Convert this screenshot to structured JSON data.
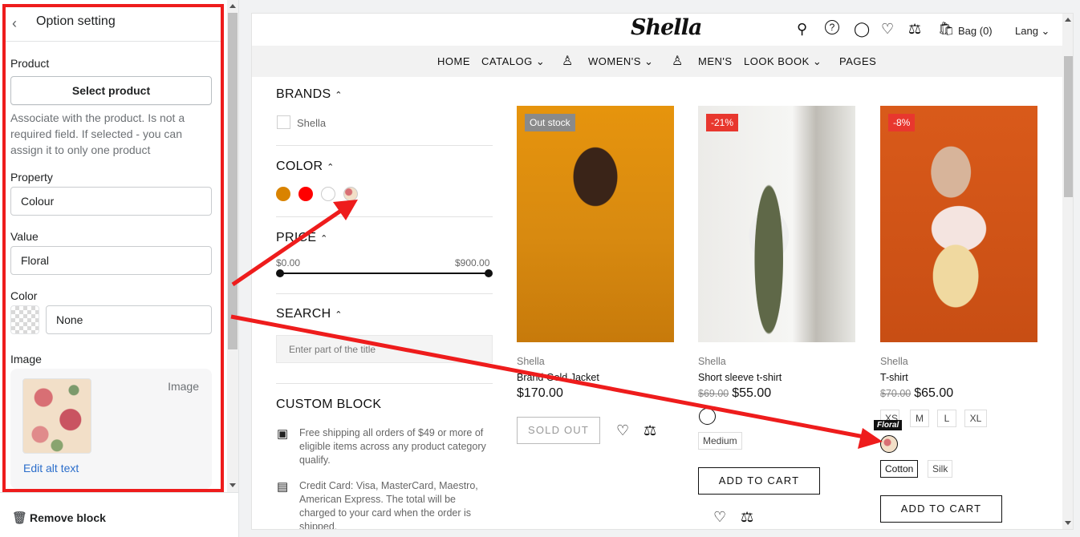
{
  "sidebar": {
    "title": "Option setting",
    "product_label": "Product",
    "select_product": "Select product",
    "help_text": "Associate with the product. Is not a required field. If selected - you can assign it to only one product",
    "property_label": "Property",
    "property_value": "Colour",
    "value_label": "Value",
    "value_value": "Floral",
    "color_label": "Color",
    "color_value": "None",
    "image_label": "Image",
    "image_word": "Image",
    "edit_alt": "Edit alt text",
    "remove_block": "Remove block"
  },
  "store": {
    "logo": "Shella",
    "bag": "Bag (0)",
    "lang": "Lang",
    "nav": [
      "HOME",
      "CATALOG",
      "WOMEN'S",
      "MEN'S",
      "LOOK BOOK",
      "PAGES"
    ]
  },
  "filters": {
    "brands_title": "BRANDS",
    "brand": "Shella",
    "color_title": "COLOR",
    "colors": [
      "#d98300",
      "#ff0000",
      "#ffffff",
      "floral"
    ],
    "price_title": "PRICE",
    "price_min": "$0.00",
    "price_max": "$900.00",
    "search_title": "SEARCH",
    "search_placeholder": "Enter part of the title",
    "custom_title": "CUSTOM BLOCK",
    "custom_items": [
      "Free shipping all orders of $49 or more of eligible items across any product category qualify.",
      "Credit Card: Visa, MasterCard, Maestro, American Express. The total will be charged to your card when the order is shipped."
    ]
  },
  "products": [
    {
      "badge": "Out stock",
      "vendor": "Shella",
      "name": "Brand Gold Jacket",
      "price": "$170.00",
      "button": "SOLD OUT"
    },
    {
      "badge": "-21%",
      "vendor": "Shella",
      "name": "Short sleeve t-shirt",
      "old_price": "$69.00",
      "price": "$55.00",
      "size": "Medium",
      "button": "ADD TO CART"
    },
    {
      "badge": "-8%",
      "vendor": "Shella",
      "name": "T-shirt",
      "old_price": "$70.00",
      "price": "$65.00",
      "sizes": [
        "XS",
        "M",
        "L",
        "XL"
      ],
      "tooltip": "Floral",
      "materials": [
        "Cotton",
        "Silk"
      ],
      "button": "ADD TO CART"
    }
  ],
  "colors": {
    "annotation": "#ee1c1c",
    "badge_gray": "#8a8a8a",
    "badge_red": "#e8372e",
    "link": "#2c6ecb"
  }
}
